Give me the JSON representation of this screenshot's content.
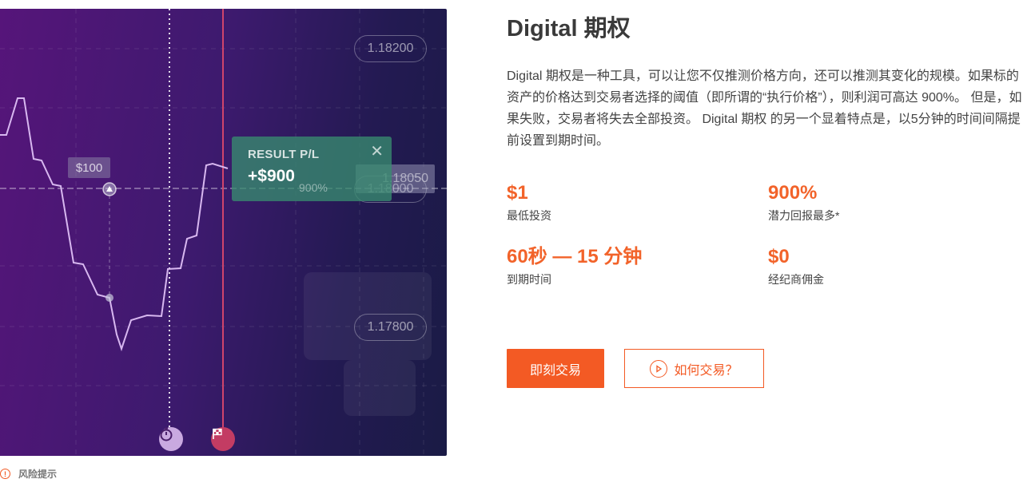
{
  "chart": {
    "price_top": "1.18200",
    "price_bottom": "1.17800",
    "price_current": "1.18000",
    "price_bubble": "1.18050",
    "investment_tag": "$100",
    "result_title": "RESULT P/L",
    "result_value": "+$900",
    "result_percent": "900%",
    "icons": [
      "stopwatch-icon",
      "finish-flag-icon",
      "close-icon"
    ]
  },
  "risk_note": "风险提示",
  "title": "Digital 期权",
  "description": "Digital 期权是一种工具，可以让您不仅推测价格方向，还可以推测其变化的规模。如果标的资产的价格达到交易者选择的阈值（即所谓的“执行价格”），则利润可高达 900%。 但是，如果失败，交易者将失去全部投资。 Digital 期权 的另一个显着特点是，以5分钟的时间间隔提前设置到期时间。",
  "stats": [
    {
      "value": "$1",
      "label": "最低投资"
    },
    {
      "value": "900%",
      "label": "潜力回报最多*"
    },
    {
      "value": "60秒 — 15 分钟",
      "label": "到期时间"
    },
    {
      "value": "$0",
      "label": "经纪商佣金"
    }
  ],
  "buttons": {
    "trade": "即刻交易",
    "how_to": "如何交易？"
  },
  "colors": {
    "accent": "#f35a24",
    "chart_bg_start": "#56157a",
    "chart_bg_end": "#1a1b45",
    "result_green": "#388c70"
  }
}
